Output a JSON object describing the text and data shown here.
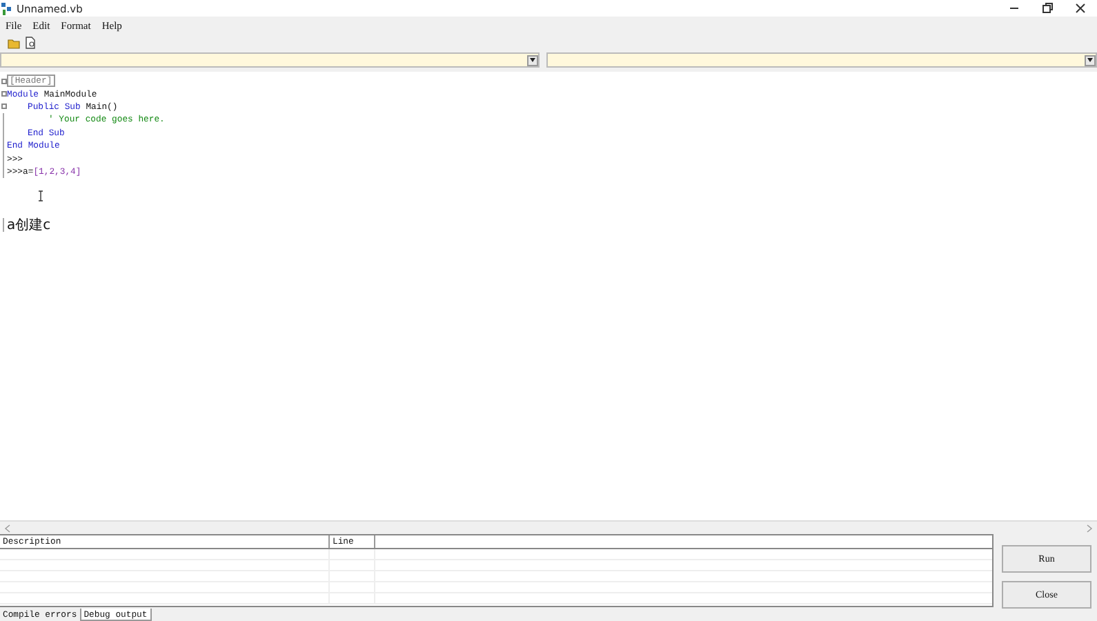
{
  "window": {
    "title": "Unnamed.vb"
  },
  "menu": [
    "File",
    "Edit",
    "Format",
    "Help"
  ],
  "editor": {
    "lines": [
      {
        "fold": true,
        "tokens": [
          {
            "kind": "tag",
            "text": "[Header]"
          }
        ]
      },
      {
        "fold": true,
        "tokens": [
          {
            "kind": "keyword",
            "text": "Module"
          },
          {
            "kind": "plain",
            "text": " MainModule"
          }
        ],
        "children": [
          {
            "fold": true,
            "tokens": [
              {
                "kind": "keyword",
                "text": "Public Sub"
              },
              {
                "kind": "plain",
                "text": " Main()"
              }
            ],
            "children": [
              {
                "fold": false,
                "tokens": [
                  {
                    "kind": "comment",
                    "text": "' Your code goes here."
                  }
                ]
              }
            ]
          },
          {
            "fold": false,
            "tokens": [
              {
                "kind": "keyword",
                "text": "End Sub"
              }
            ]
          }
        ]
      },
      {
        "fold": false,
        "tokens": [
          {
            "kind": "keyword",
            "text": "End Module"
          }
        ]
      },
      {
        "fold": false,
        "tokens": [
          {
            "kind": "plain",
            "text": ">>>"
          }
        ]
      },
      {
        "fold": false,
        "tokens": [
          {
            "kind": "plain",
            "text": ">>>a="
          },
          {
            "kind": "number",
            "text": "[1,2,3,4]"
          }
        ]
      }
    ],
    "typed_text": "a创建c"
  },
  "errors": {
    "columns": [
      "Description",
      "Line"
    ]
  },
  "tabs": [
    {
      "label": "Compile errors",
      "selected": false
    },
    {
      "label": "Debug output",
      "selected": true
    }
  ],
  "buttons": [
    "Run",
    "Close"
  ]
}
